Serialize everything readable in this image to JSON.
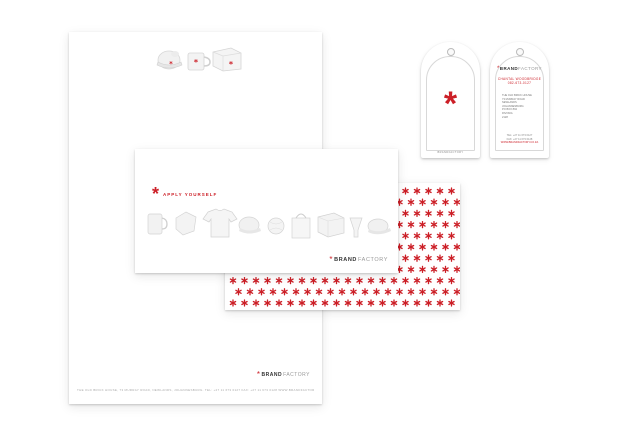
{
  "colors": {
    "accent": "#cc1f27",
    "paper": "#ffffff",
    "text": "#333333",
    "muted": "#9a9a9a"
  },
  "brand": {
    "mark": "*",
    "part1": "BRAND",
    "part2": "FACTORY"
  },
  "greeting_card": {
    "headline": "APPLY YOURSELF"
  },
  "letterhead": {
    "address_line": "THE OLD BRICK HOUSE, 73 MURRAY ROAD, NEWLANDS, JOHANNESBURG. TEL: +27 11 673 0127 FAX: +27 11 673 0128  WWW.BRANDFACTORY.CO.ZA"
  },
  "hang_tag": {
    "contact_name": "CHANTAL WOODBRIDGE",
    "contact_phone": "082-673-0127",
    "address_lines": [
      "THE OLD BRICK HOUSE",
      "73 MURRAY ROAD",
      "NEWLANDS",
      "JOHANNESBURG",
      "PO BOX 894",
      "RIVONIA",
      "2128"
    ],
    "phone_lines": [
      "TEL: +27 11 673 0127",
      "FAX: +27 11 673 0128"
    ],
    "website": "WWW.BRANDFACTORY.CO.ZA"
  },
  "icons": [
    "mug-icon",
    "cap-icon",
    "box-icon",
    "tshirt-icon",
    "ball-icon",
    "bag-icon",
    "cup-icon"
  ]
}
